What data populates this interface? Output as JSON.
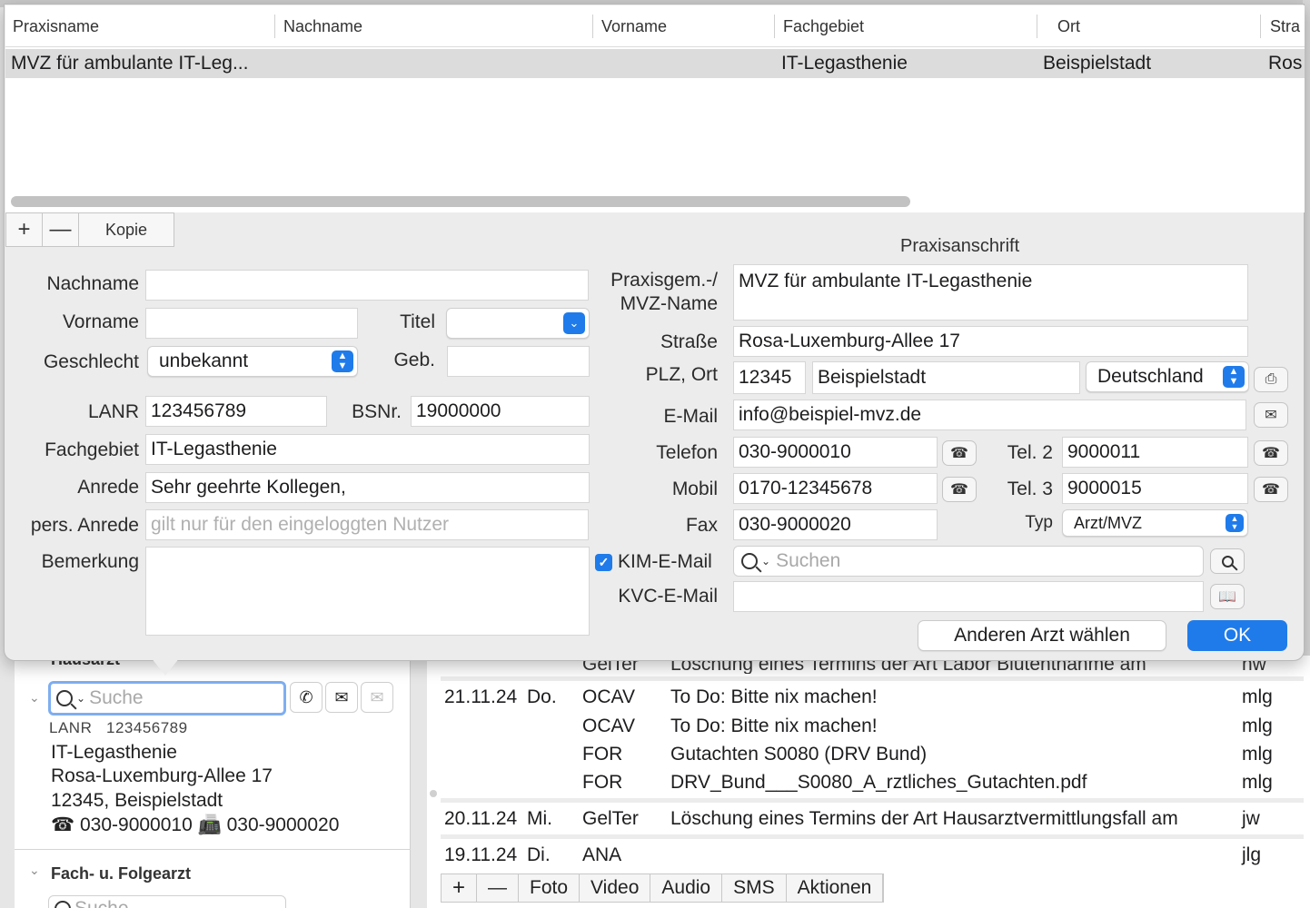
{
  "table": {
    "columns": [
      "Praxisname",
      "Nachname",
      "Vorname",
      "Fachgebiet",
      "Ort",
      "Stra"
    ],
    "rows": [
      {
        "praxisname": "MVZ für ambulante IT-Leg...",
        "nachname": "",
        "vorname": "",
        "fachgebiet": "IT-Legasthenie",
        "ort": "Beispielstadt",
        "strasse": "Ros"
      }
    ]
  },
  "toolbar": {
    "add": "+",
    "remove": "—",
    "copy": "Kopie"
  },
  "form": {
    "nachname_label": "Nachname",
    "nachname_value": "",
    "vorname_label": "Vorname",
    "vorname_value": "",
    "titel_label": "Titel",
    "titel_value": "",
    "geschlecht_label": "Geschlecht",
    "geschlecht_value": "unbekannt",
    "geb_label": "Geb.",
    "geb_value": "",
    "lanr_label": "LANR",
    "lanr_value": "123456789",
    "bsnr_label": "BSNr.",
    "bsnr_value": "19000000",
    "fachgebiet_label": "Fachgebiet",
    "fachgebiet_value": "IT-Legasthenie",
    "anrede_label": "Anrede",
    "anrede_value": "Sehr geehrte Kollegen,",
    "pers_anrede_label": "pers. Anrede",
    "pers_anrede_placeholder": "gilt nur für den eingeloggten Nutzer",
    "bemerkung_label": "Bemerkung",
    "bemerkung_value": ""
  },
  "address": {
    "section_title": "Praxisanschrift",
    "praxisname_label_1": "Praxisgem.-/",
    "praxisname_label_2": "MVZ-Name",
    "praxisname_value": "MVZ für ambulante IT-Legasthenie",
    "strasse_label": "Straße",
    "strasse_value": "Rosa-Luxemburg-Allee 17",
    "plz_ort_label": "PLZ, Ort",
    "plz_value": "12345",
    "ort_value": "Beispielstadt",
    "land_value": "Deutschland",
    "email_label": "E-Mail",
    "email_value": "info@beispiel-mvz.de",
    "telefon_label": "Telefon",
    "telefon_value": "030-9000010",
    "tel2_label": "Tel. 2",
    "tel2_value": "9000011",
    "mobil_label": "Mobil",
    "mobil_value": "0170-12345678",
    "tel3_label": "Tel. 3",
    "tel3_value": "9000015",
    "fax_label": "Fax",
    "fax_value": "030-9000020",
    "typ_label": "Typ",
    "typ_value": "Arzt/MVZ",
    "kim_label": "KIM-E-Mail",
    "kim_placeholder": "Suchen",
    "kvc_label": "KVC-E-Mail",
    "kvc_value": ""
  },
  "actions": {
    "other_doctor": "Anderen Arzt wählen",
    "ok": "OK"
  },
  "left_panel": {
    "hausarzt_header": "Hausarzt",
    "search_placeholder": "Suche",
    "lanr_label": "LANR",
    "lanr_value": "123456789",
    "fachgebiet": "IT-Legasthenie",
    "strasse": "Rosa-Luxemburg-Allee 17",
    "plz_ort": "12345, Beispielstadt",
    "phone_fax": "☎ 030-9000010 📠 030-9000020",
    "fach_header": "Fach- u. Folgearzt",
    "fach_search_placeholder": "Suche"
  },
  "log": {
    "partial": {
      "date": "",
      "day": "",
      "code": "GelTer",
      "text": "Löschung eines Termins der Art Labor Blutentnahme am",
      "user": "nw"
    },
    "rows": [
      {
        "date": "21.11.24",
        "day": "Do.",
        "code": "OCAV",
        "text": "To Do: Bitte nix machen!",
        "user": "mlg"
      },
      {
        "date": "",
        "day": "",
        "code": "OCAV",
        "text": "To Do: Bitte nix machen!",
        "user": "mlg"
      },
      {
        "date": "",
        "day": "",
        "code": "FOR",
        "text": "Gutachten S0080 (DRV Bund)",
        "user": "mlg"
      },
      {
        "date": "",
        "day": "",
        "code": "FOR",
        "text": "DRV_Bund___S0080_A_rztliches_Gutachten.pdf",
        "user": "mlg"
      },
      {
        "date": "20.11.24",
        "day": "Mi.",
        "code": "GelTer",
        "text": "Löschung eines Termins der Art Hausarztvermittlungsfall am",
        "user": "jw"
      },
      {
        "date": "19.11.24",
        "day": "Di.",
        "code": "ANA",
        "text": "",
        "user": "jlg"
      }
    ],
    "bottom_bar": [
      "+",
      "—",
      "Foto",
      "Video",
      "Audio",
      "SMS",
      "Aktionen"
    ]
  }
}
